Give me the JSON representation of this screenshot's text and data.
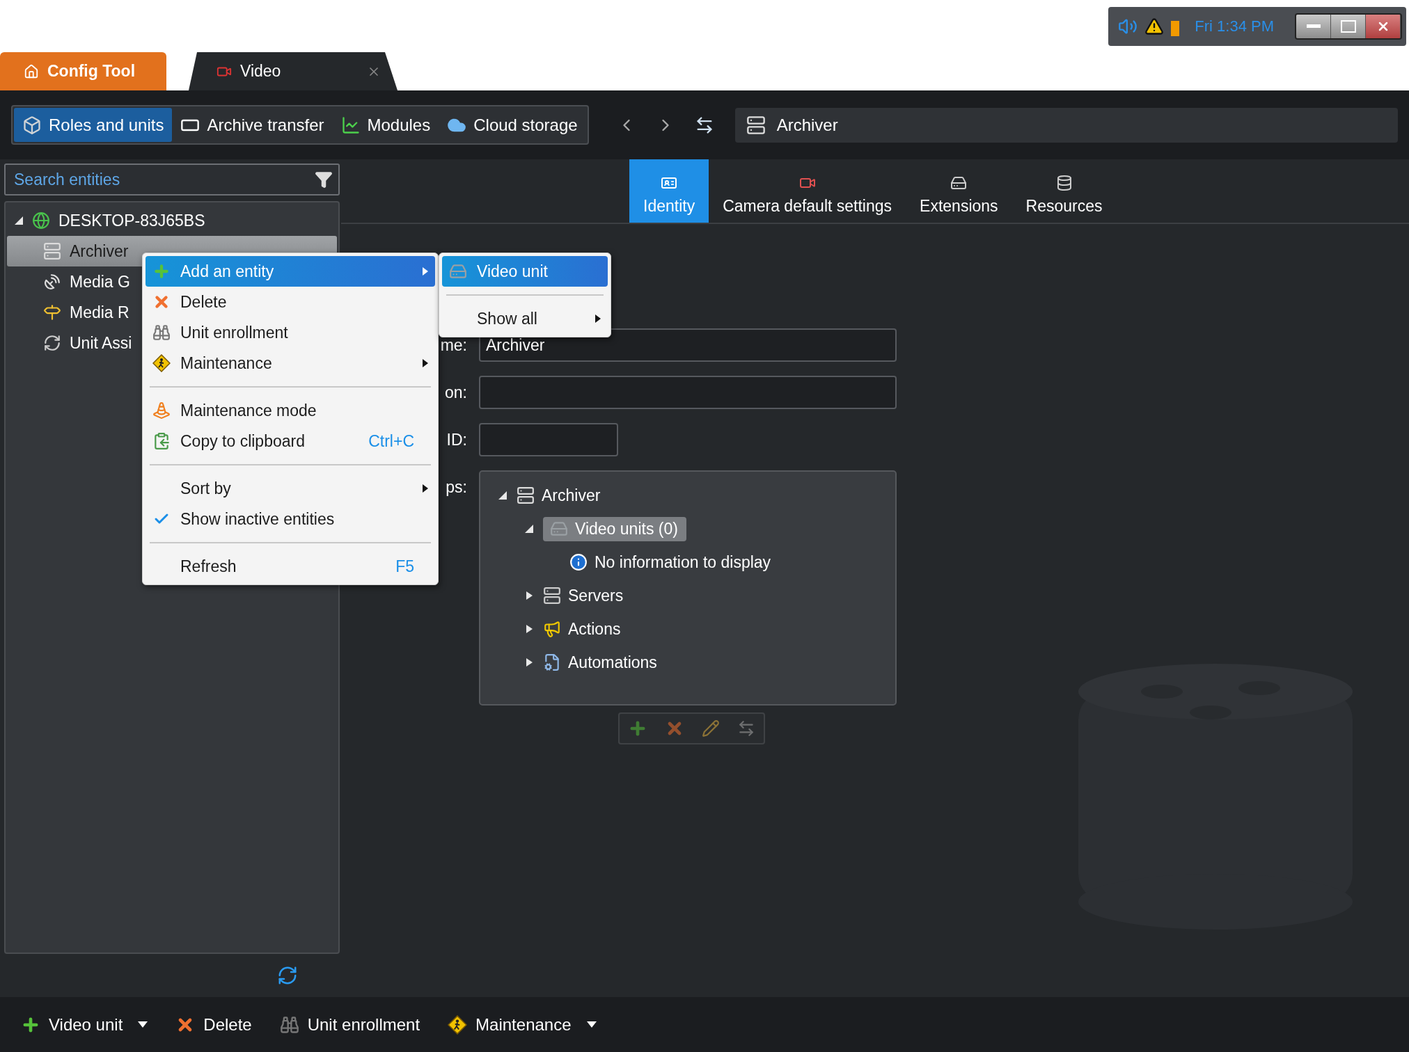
{
  "system_tray": {
    "time": "Fri 1:34 PM"
  },
  "app_tabs": [
    {
      "label": "Config Tool",
      "kind": "home",
      "selected": false
    },
    {
      "label": "Video",
      "kind": "video",
      "selected": true,
      "closable": true
    }
  ],
  "toolbar": {
    "segments": [
      {
        "label": "Roles and units",
        "kind": "roles",
        "selected": true
      },
      {
        "label": "Archive transfer",
        "kind": "archive",
        "selected": false
      },
      {
        "label": "Modules",
        "kind": "modules",
        "selected": false
      },
      {
        "label": "Cloud storage",
        "kind": "cloud",
        "selected": false
      }
    ],
    "breadcrumb": "Archiver"
  },
  "search": {
    "placeholder": "Search entities"
  },
  "entity_tree": [
    {
      "label": "DESKTOP-83J65BS",
      "kind": "globe",
      "expanded": true,
      "selected": false,
      "children": [
        {
          "label": "Archiver",
          "kind": "archiver",
          "selected": true
        },
        {
          "label": "Media G",
          "kind": "gateway",
          "selected": false
        },
        {
          "label": "Media R",
          "kind": "router",
          "selected": false
        },
        {
          "label": "Unit Assi",
          "kind": "assistant",
          "selected": false
        }
      ]
    }
  ],
  "entity_tabs": [
    {
      "label": "Identity",
      "kind": "identity",
      "selected": true
    },
    {
      "label": "Camera default settings",
      "kind": "camera",
      "selected": false
    },
    {
      "label": "Extensions",
      "kind": "extensions",
      "selected": false
    },
    {
      "label": "Resources",
      "kind": "resources",
      "selected": false
    }
  ],
  "form": {
    "fields": [
      {
        "label": "me:",
        "value": "Archiver",
        "kind": "wide"
      },
      {
        "label": "on:",
        "kind": "wide"
      },
      {
        "label": "ID:",
        "kind": "short"
      }
    ],
    "relationships_label": "ps:",
    "relationships": [
      {
        "label": "Archiver",
        "kind": "archiver",
        "expanded": true,
        "selected": false,
        "children": [
          {
            "label": "Video units (0)",
            "kind": "video-unit",
            "expanded": true,
            "selected": true,
            "children": [
              {
                "label": "No information to display",
                "kind": "info",
                "selected": false
              }
            ]
          },
          {
            "label": "Servers",
            "kind": "servers",
            "expanded": false,
            "selected": false
          },
          {
            "label": "Actions",
            "kind": "actions",
            "expanded": false,
            "selected": false
          },
          {
            "label": "Automations",
            "kind": "automations",
            "expanded": false,
            "selected": false
          }
        ]
      }
    ]
  },
  "context_menu": {
    "groups": [
      [
        {
          "label": "Add an entity",
          "kind": "add",
          "submenu": true,
          "selected": true,
          "checked": false
        },
        {
          "label": "Delete",
          "kind": "delete",
          "submenu": false,
          "selected": false,
          "checked": false
        },
        {
          "label": "Unit enrollment",
          "kind": "enrollment",
          "submenu": false,
          "selected": false,
          "checked": false
        },
        {
          "label": "Maintenance",
          "kind": "maintenance",
          "submenu": true,
          "selected": false,
          "checked": false
        }
      ],
      [
        {
          "label": "Maintenance mode",
          "kind": "cone",
          "submenu": false,
          "selected": false,
          "checked": false
        },
        {
          "label": "Copy to clipboard",
          "kind": "copy",
          "shortcut": "Ctrl+C",
          "submenu": false,
          "selected": false,
          "checked": false
        }
      ],
      [
        {
          "label": "Sort by",
          "kind": "plain",
          "submenu": true,
          "selected": false,
          "checked": false
        },
        {
          "label": "Show inactive entities",
          "kind": "plain",
          "submenu": false,
          "selected": false,
          "checked": true
        }
      ],
      [
        {
          "label": "Refresh",
          "kind": "plain",
          "shortcut": "F5",
          "submenu": false,
          "selected": false,
          "checked": false
        }
      ]
    ]
  },
  "submenu": {
    "groups": [
      [
        {
          "label": "Video unit",
          "kind": "video-unit",
          "submenu": false,
          "selected": true
        }
      ],
      [
        {
          "label": "Show all",
          "kind": "plain",
          "submenu": true,
          "selected": false
        }
      ]
    ]
  },
  "bottom_bar": [
    {
      "label": "Video unit",
      "kind": "add",
      "dropdown": true
    },
    {
      "label": "Delete",
      "kind": "delete",
      "dropdown": false
    },
    {
      "label": "Unit enrollment",
      "kind": "enrollment",
      "dropdown": false
    },
    {
      "label": "Maintenance",
      "kind": "maintenance",
      "dropdown": true
    }
  ]
}
